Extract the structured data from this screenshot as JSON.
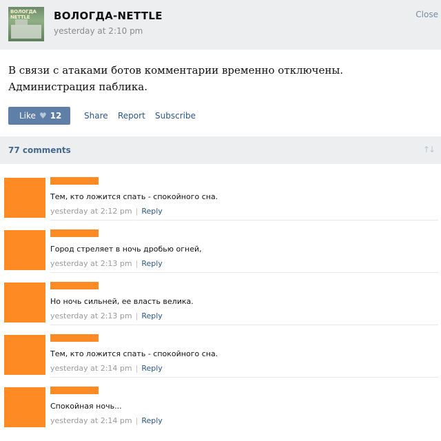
{
  "post": {
    "group_name": "ВОЛОГДА-NETTLE",
    "avatar_text": "ВОЛОГДА NETTLE",
    "time": "yesterday at 2:10 pm",
    "close_label": "Close",
    "text": "В связи с атаками ботов комментарии временно отключены. Администрация паблика."
  },
  "actions": {
    "like_label": "Like",
    "like_count": "12",
    "share_label": "Share",
    "report_label": "Report",
    "subscribe_label": "Subscribe"
  },
  "comments_header": {
    "count_label": "77 comments"
  },
  "comments": [
    {
      "text": "Тем, кто ложится спать - спокойного сна.",
      "time": "yesterday at 2:12 pm",
      "reply": "Reply"
    },
    {
      "text": "Город стреляет в ночь дробью огней,",
      "time": "yesterday at 2:13 pm",
      "reply": "Reply"
    },
    {
      "text": "Но ночь сильней, ее власть велика.",
      "time": "yesterday at 2:13 pm",
      "reply": "Reply"
    },
    {
      "text": "Тем, кто ложится спать - спокойного сна.",
      "time": "yesterday at 2:14 pm",
      "reply": "Reply"
    },
    {
      "text": "Спокойная ночь...",
      "time": "yesterday at 2:14 pm",
      "reply": "Reply"
    }
  ],
  "colors": {
    "header_bg": "#edeef0",
    "like_button": "#5f7ea8",
    "link": "#2b5788",
    "redaction": "#fd8a22"
  }
}
